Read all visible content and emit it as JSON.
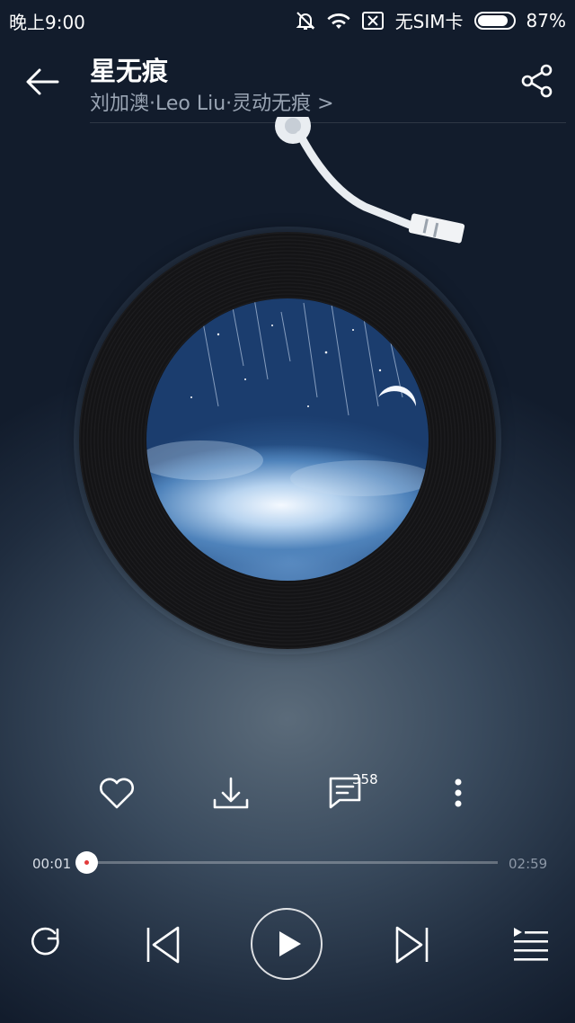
{
  "status_bar": {
    "time": "晚上9:00",
    "carrier": "无SIM卡",
    "battery_percent": "87%",
    "battery_level": 0.87,
    "icons": [
      "mute-bell-icon",
      "wifi-icon",
      "no-sim-icon",
      "battery-icon"
    ]
  },
  "header": {
    "title": "星无痕",
    "subtitle": "刘加澳·Leo Liu·灵动无痕 >",
    "back_icon": "back-arrow-icon",
    "share_icon": "share-icon"
  },
  "actions": {
    "favorite_icon": "heart-icon",
    "download_icon": "download-icon",
    "comments_icon": "comment-icon",
    "comments_count": "358",
    "more_icon": "more-vertical-icon"
  },
  "progress": {
    "current": "00:01",
    "total": "02:59",
    "fraction": 0.006
  },
  "controls": {
    "repeat_icon": "repeat-icon",
    "previous_icon": "previous-icon",
    "play_icon": "play-icon",
    "next_icon": "next-icon",
    "playlist_icon": "playlist-icon"
  },
  "colors": {
    "progress_accent": "#e84545"
  }
}
